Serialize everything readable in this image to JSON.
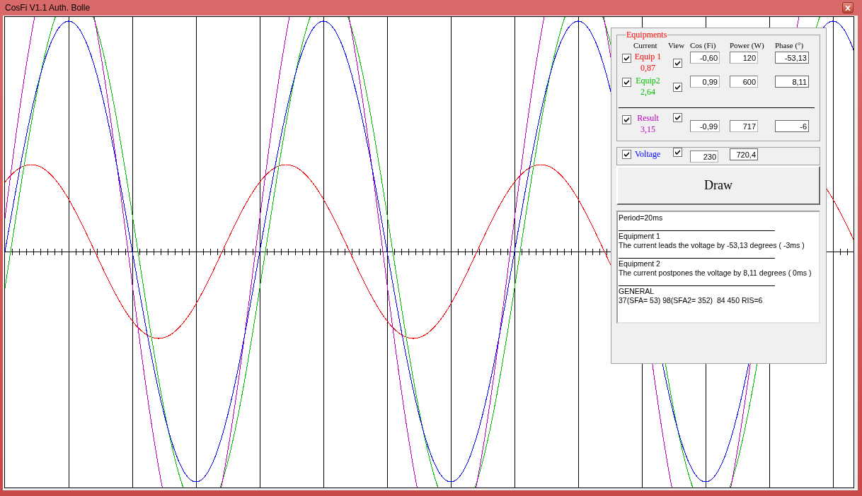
{
  "window": {
    "title": "CosFi V1.1 Auth. Bolle"
  },
  "equipments": {
    "legend": "Equipments",
    "columns": [
      "Current",
      "View",
      "Cos (Fi)",
      "Power (W)",
      "Phase (°)"
    ],
    "rows": [
      {
        "kind": "equipment",
        "name": "Equip 1",
        "current": "0,87",
        "color": "#ff0000",
        "checked": true,
        "view": true,
        "cos": "-0,60",
        "power": "120",
        "phase": "-53,13"
      },
      {
        "kind": "equipment",
        "name": "Equip2",
        "current": "2,64",
        "color": "#00c000",
        "checked": true,
        "view": true,
        "cos": "0,99",
        "power": "600",
        "phase": "8,11"
      },
      {
        "kind": "result",
        "name": "Result",
        "current": "3,15",
        "color": "#c000c0",
        "checked": true,
        "view": true,
        "cos": "-0,99",
        "power": "717",
        "phase": "-6"
      }
    ]
  },
  "voltage": {
    "name": "Voltage",
    "color": "#0000ff",
    "checked": true,
    "view": true,
    "value": "230",
    "power": "720,4"
  },
  "draw_button": {
    "label": "Draw"
  },
  "report": {
    "header": "Period=20ms",
    "sections": [
      {
        "title": "Equipment 1",
        "text": "The current leads the voltage by -53,13 degrees ( -3ms )"
      },
      {
        "title": "Equipment 2",
        "text": "The current postpones the voltage by 8,11 degrees ( 0ms )"
      },
      {
        "title": "GENERAL",
        "text": "37(SFA= 53) 98(SFA2= 352)  84 450 RIS=6"
      }
    ]
  }
}
